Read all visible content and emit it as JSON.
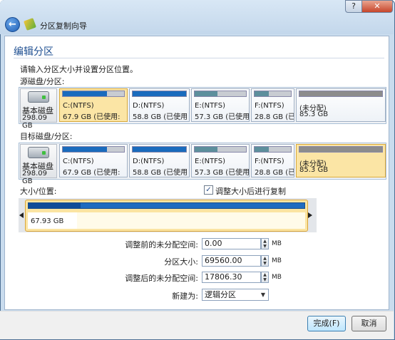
{
  "window": {
    "title": "分区复制向导",
    "help_label": "?",
    "close_label": "✕",
    "back_label": "←"
  },
  "page": {
    "title": "编辑分区",
    "instruction": "请输入分区大小并设置分区位置。",
    "source_label": "源磁盘/分区:",
    "target_label": "目标磁盘/分区:",
    "size_label": "大小/位置:",
    "copy_after_resize_label": "调整大小后进行复制",
    "copy_after_resize_checked": true
  },
  "disk": {
    "type": "基本磁盘",
    "size": "298.09 GB"
  },
  "source_partitions": [
    {
      "name": "C:(NTFS)",
      "detail": "67.9 GB (已使用:",
      "selected": true,
      "used_fraction": 0.72,
      "color": "#1a6bbd"
    },
    {
      "name": "D:(NTFS)",
      "detail": "58.8 GB (已使用",
      "selected": false,
      "used_fraction": 1.0,
      "color": "#1a6bbd"
    },
    {
      "name": "E:(NTFS)",
      "detail": "57.3 GB (已使用",
      "selected": false,
      "used_fraction": 0.45,
      "color": "#5d8f9c"
    },
    {
      "name": "F:(NTFS)",
      "detail": "28.8 GB (已使用",
      "selected": false,
      "used_fraction": 0.4,
      "color": "#5d8f9c"
    },
    {
      "name": "(未分配)",
      "detail": "85.3 GB",
      "selected": false,
      "used_fraction": 1.0,
      "color": "#8c8c8c"
    }
  ],
  "target_partitions": [
    {
      "name": "C:(NTFS)",
      "detail": "67.9 GB (已使用:",
      "selected": false,
      "used_fraction": 0.72,
      "color": "#1a6bbd"
    },
    {
      "name": "D:(NTFS)",
      "detail": "58.8 GB (已使用",
      "selected": false,
      "used_fraction": 1.0,
      "color": "#1a6bbd"
    },
    {
      "name": "E:(NTFS)",
      "detail": "57.3 GB (已使用",
      "selected": false,
      "used_fraction": 0.45,
      "color": "#5d8f9c"
    },
    {
      "name": "F:(NTFS)",
      "detail": "28.8 GB (已使用",
      "selected": false,
      "used_fraction": 0.4,
      "color": "#5d8f9c"
    },
    {
      "name": "(未分配)",
      "detail": "85.3 GB",
      "selected": true,
      "used_fraction": 1.0,
      "color": "#8c8c8c"
    }
  ],
  "slider": {
    "size_text": "67.93 GB"
  },
  "fields": {
    "before_label": "调整前的未分配空间:",
    "before_value": "0.00",
    "size_label": "分区大小:",
    "size_value": "69560.00",
    "after_label": "调整后的未分配空间:",
    "after_value": "17806.30",
    "unit": "MB",
    "new_as_label": "新建为:",
    "new_as_value": "逻辑分区"
  },
  "buttons": {
    "finish": "完成(F)",
    "cancel": "取消"
  }
}
